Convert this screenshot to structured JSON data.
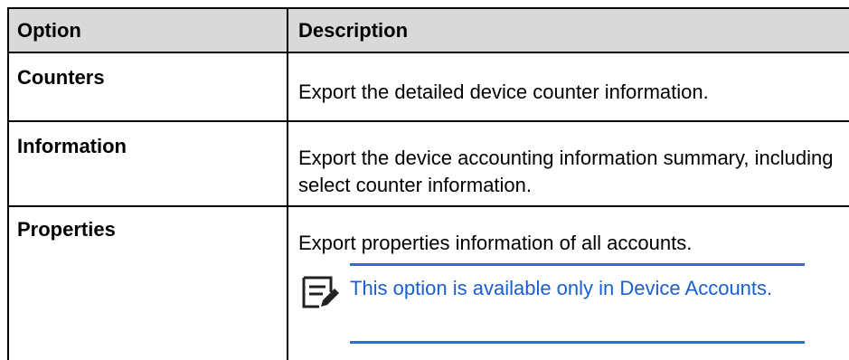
{
  "table": {
    "headers": {
      "option": "Option",
      "description": "Description"
    },
    "rows": [
      {
        "option": "Counters",
        "description": "Export the detailed device counter information."
      },
      {
        "option": "Information",
        "description": "Export the device accounting information summary, including select counter information."
      },
      {
        "option": "Properties",
        "description": "Export properties information of all accounts."
      }
    ],
    "note": {
      "icon": "note-edit-icon",
      "text": "This option is available only in Device Accounts.",
      "color": "#1a5fd0"
    }
  }
}
